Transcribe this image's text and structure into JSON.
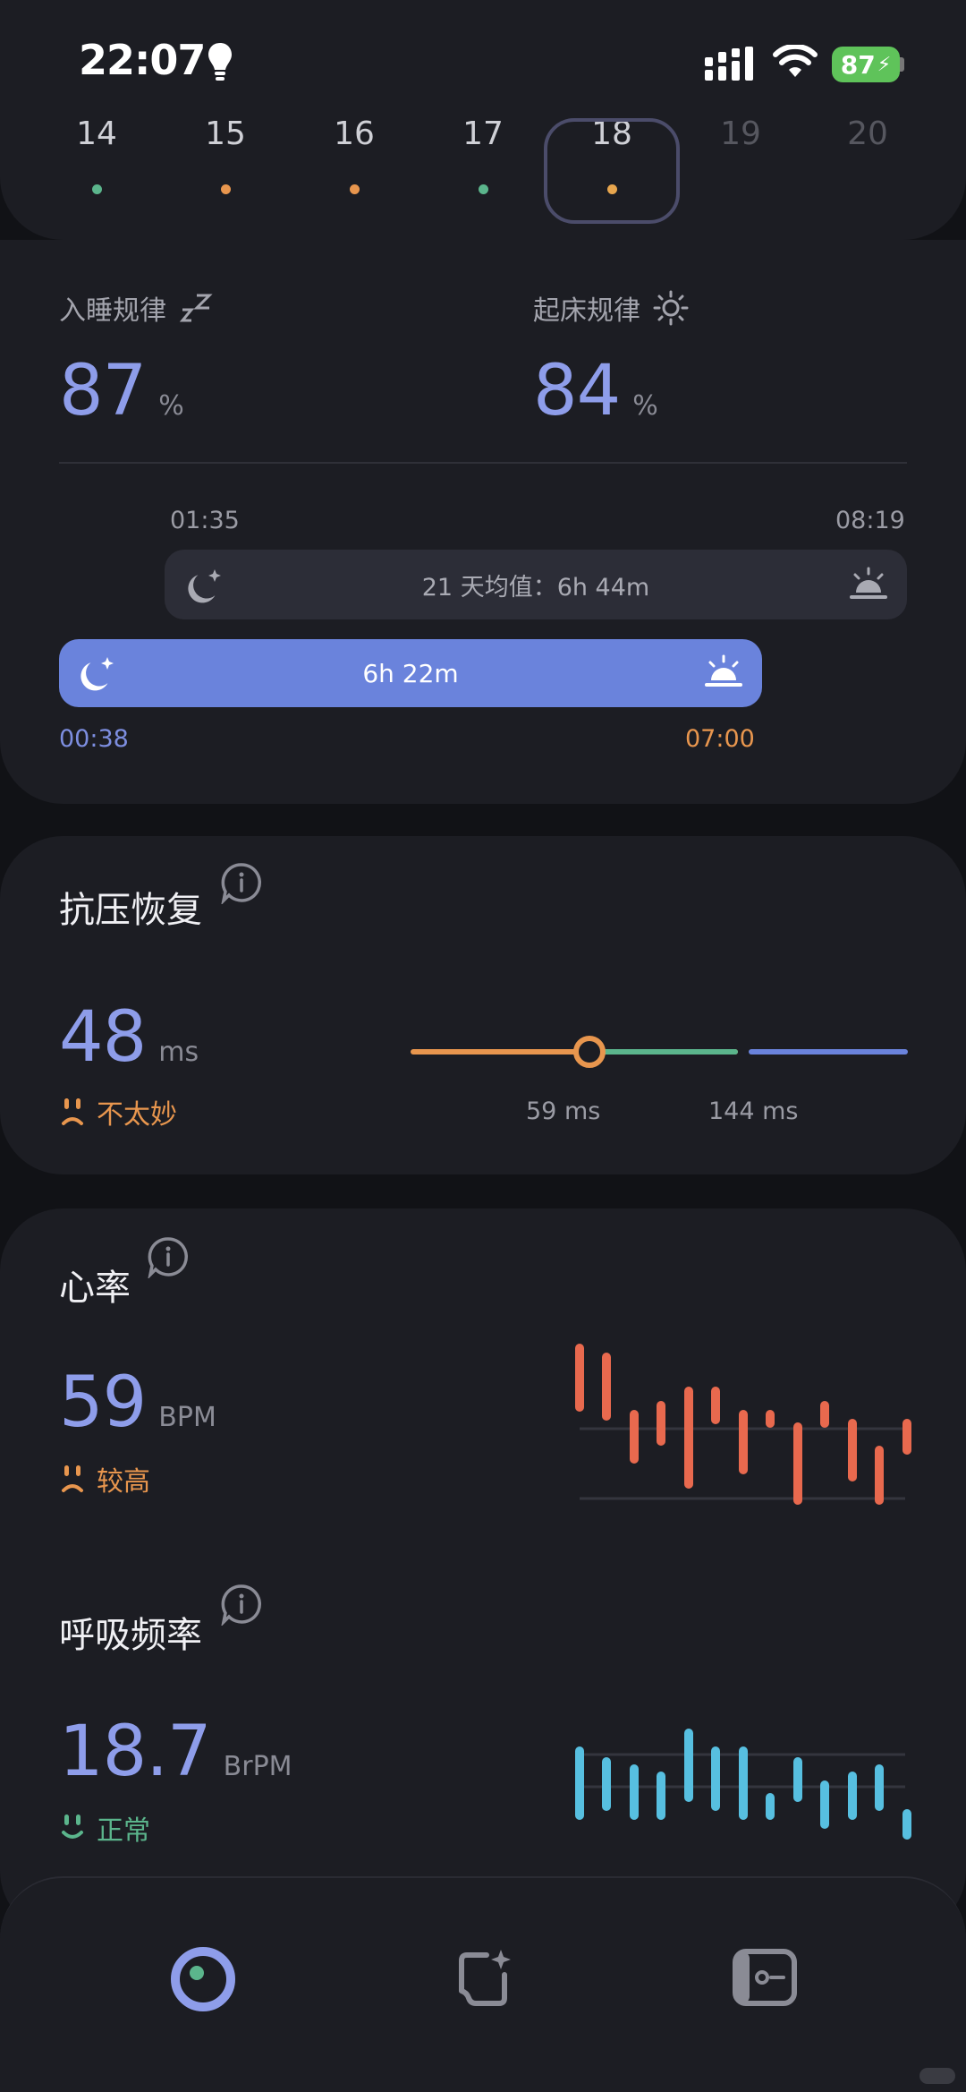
{
  "status_bar": {
    "time": "22:07",
    "battery": "87"
  },
  "dates": [
    {
      "day": "14",
      "dot": "#5bb58c",
      "dim": false
    },
    {
      "day": "15",
      "dot": "#e8964e",
      "dim": false
    },
    {
      "day": "16",
      "dot": "#e8964e",
      "dim": false
    },
    {
      "day": "17",
      "dot": "#5bb58c",
      "dim": false
    },
    {
      "day": "18",
      "dot": "#e8a64e",
      "dim": false
    },
    {
      "day": "19",
      "dot": null,
      "dim": true
    },
    {
      "day": "20",
      "dot": null,
      "dim": true
    }
  ],
  "selected_day": "18",
  "sleep": {
    "bedtime_label": "入睡规律",
    "bedtime_value": "87",
    "bedtime_unit": "%",
    "wake_label": "起床规律",
    "wake_value": "84",
    "wake_unit": "%",
    "avg_start": "01:35",
    "avg_end": "08:19",
    "avg_text": "21 天均值：6h 44m",
    "duration": "6h 22m",
    "start": "00:38",
    "end": "07:00"
  },
  "stress": {
    "title": "抗压恢复",
    "value": "48",
    "unit": "ms",
    "status": "不太妙",
    "low_label": "59 ms",
    "high_label": "144 ms",
    "marker_fraction": 0.84
  },
  "heart": {
    "title": "心率",
    "value": "59",
    "unit": "BPM",
    "status": "较高"
  },
  "breath": {
    "title": "呼吸频率",
    "value": "18.7",
    "unit": "BrPM",
    "status": "正常"
  },
  "colors": {
    "accent": "#8e9dea",
    "warn": "#e8964e",
    "good": "#5bb58c",
    "heart": "#e8694e",
    "breath": "#57bfe0"
  },
  "icons": [
    "bulb-icon",
    "signal-icon",
    "wifi-icon",
    "moon-icon",
    "sunrise-icon",
    "sun-icon",
    "zzz-icon",
    "info-icon",
    "sad-face-icon",
    "smile-face-icon",
    "ring-icon",
    "sparkle-card-icon",
    "id-card-icon"
  ]
}
